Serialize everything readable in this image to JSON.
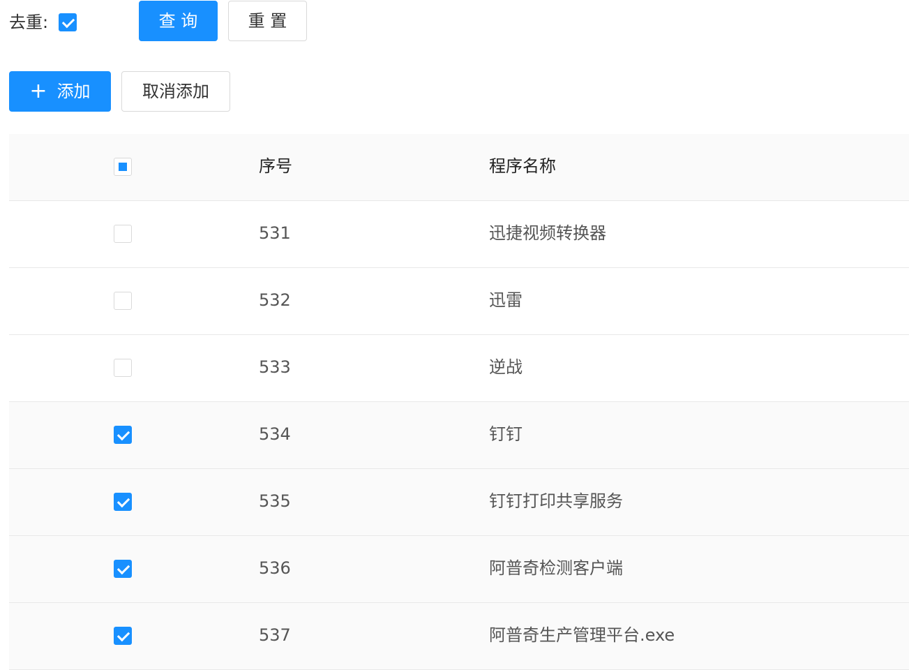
{
  "filter": {
    "dedupe_label": "去重:",
    "dedupe_checked": true,
    "query_label": "查 询",
    "reset_label": "重 置"
  },
  "actions": {
    "add_icon": "plus-icon",
    "add_label": "添加",
    "cancel_add_label": "取消添加"
  },
  "table": {
    "columns": [
      "序号",
      "程序名称"
    ],
    "header_check_state": "indeterminate",
    "rows": [
      {
        "index": "531",
        "name": "迅捷视频转换器",
        "checked": false
      },
      {
        "index": "532",
        "name": "迅雷",
        "checked": false
      },
      {
        "index": "533",
        "name": "逆战",
        "checked": false
      },
      {
        "index": "534",
        "name": "钉钉",
        "checked": true
      },
      {
        "index": "535",
        "name": "钉钉打印共享服务",
        "checked": true
      },
      {
        "index": "536",
        "name": "阿普奇检测客户端",
        "checked": true
      },
      {
        "index": "537",
        "name": "阿普奇生产管理平台.exe",
        "checked": true
      }
    ]
  },
  "colors": {
    "primary": "#1890ff",
    "border": "#d9d9d9",
    "row_selected_bg": "#fafafa"
  }
}
